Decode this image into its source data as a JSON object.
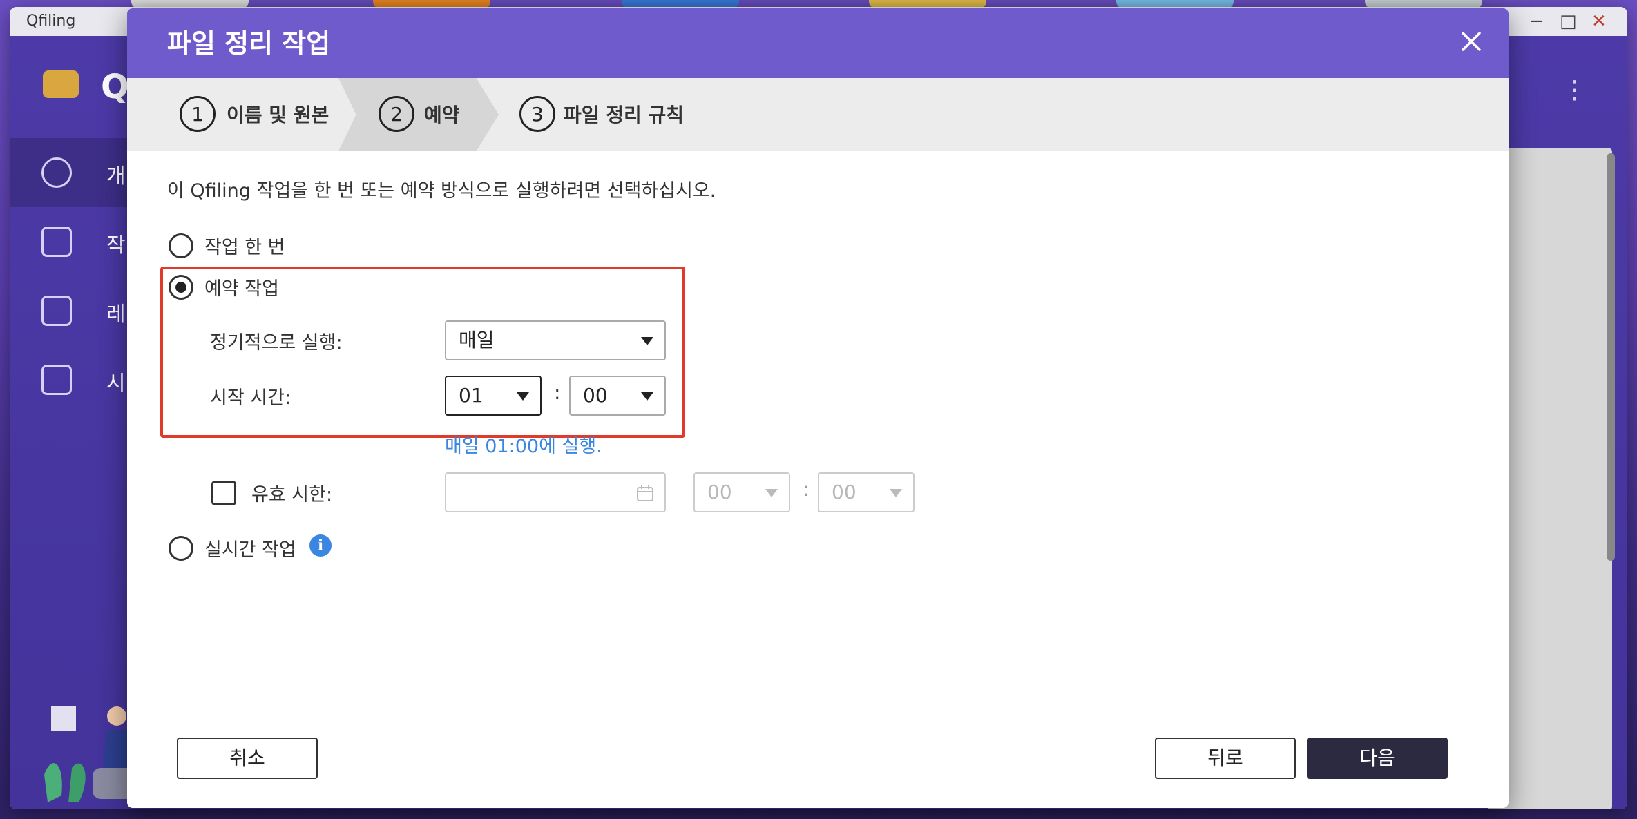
{
  "app": {
    "title": "Qfiling",
    "logo_text": "Q",
    "sidebar": [
      {
        "label": "개",
        "icon": "speedometer-icon"
      },
      {
        "label": "작",
        "icon": "task-list-icon"
      },
      {
        "label": "레",
        "icon": "bookmark-icon"
      },
      {
        "label": "시",
        "icon": "clipboard-icon"
      }
    ],
    "window_controls": {
      "minimize": "−",
      "maximize": "□",
      "close": "✕"
    },
    "kebab": "⋮"
  },
  "dialog": {
    "title": "파일 정리 작업",
    "steps": [
      {
        "num": "1",
        "label": "이름 및 원본"
      },
      {
        "num": "2",
        "label": "예약"
      },
      {
        "num": "3",
        "label": "파일 정리 규칙"
      }
    ],
    "intro": "이 Qfiling 작업을 한 번 또는 예약 방식으로 실행하려면 선택하십시오.",
    "options": {
      "once": "작업 한 번",
      "scheduled": "예약 작업",
      "realtime": "실시간 작업"
    },
    "schedule": {
      "repeat_label": "정기적으로 실행:",
      "repeat_value": "매일",
      "start_label": "시작 시간:",
      "hour": "01",
      "minute": "00",
      "colon": ":",
      "hint": "매일 01:00에 실행."
    },
    "expiry": {
      "label": "유효 시한:",
      "date_value": "",
      "hour": "00",
      "minute": "00"
    },
    "buttons": {
      "cancel": "취소",
      "back": "뒤로",
      "next": "다음"
    }
  },
  "colors": {
    "header": "#6f5bcc",
    "highlight": "#e03a2a",
    "hint": "#3a86e0",
    "primary_button": "#2b2a40"
  }
}
